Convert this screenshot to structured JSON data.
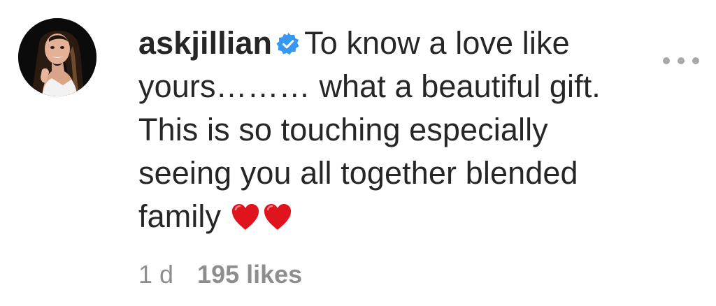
{
  "comment": {
    "username": "askjillian",
    "verified": true,
    "avatar_icon": "profile-photo",
    "text": "To know a love like yours……… what a beautiful gift. This is so touching especially seeing you all together blended family ",
    "emojis": [
      "red-heart",
      "red-heart"
    ],
    "time": "1 d",
    "likes": "195 likes",
    "more_icon": "more-options-icon"
  },
  "colors": {
    "text": "#262626",
    "meta": "#8e8e8e",
    "verified": "#3897f0",
    "heart": "#e0141f",
    "dots": "#a8a8a8"
  }
}
